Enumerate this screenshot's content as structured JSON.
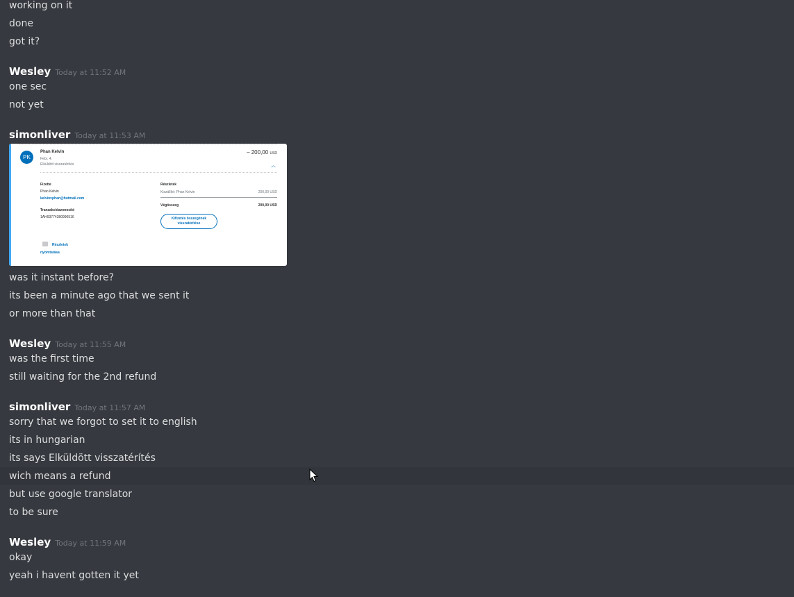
{
  "messages": [
    {
      "type": "line",
      "text": "working on it"
    },
    {
      "type": "line",
      "text": "done"
    },
    {
      "type": "line",
      "text": "got it?"
    },
    {
      "type": "header",
      "username": "Wesley",
      "timestamp": "Today at 11:52 AM"
    },
    {
      "type": "line",
      "text": "one sec"
    },
    {
      "type": "line",
      "text": "not yet"
    },
    {
      "type": "header",
      "username": "simonliver",
      "timestamp": "Today at 11:53 AM"
    },
    {
      "type": "line",
      "text": "was it instant before?"
    },
    {
      "type": "line",
      "text": "its been a minute ago that we sent it"
    },
    {
      "type": "line",
      "text": "or more than that"
    },
    {
      "type": "header",
      "username": "Wesley",
      "timestamp": "Today at 11:55 AM"
    },
    {
      "type": "line",
      "text": "was the first time"
    },
    {
      "type": "line",
      "text": "still waiting for the 2nd refund"
    },
    {
      "type": "header",
      "username": "simonliver",
      "timestamp": "Today at 11:57 AM"
    },
    {
      "type": "line",
      "text": "sorry that we forgot to set it to english"
    },
    {
      "type": "line",
      "text": "its in hungarian"
    },
    {
      "type": "line",
      "text": "its says Elküldött visszatérítés"
    },
    {
      "type": "line",
      "text": "wich means a refund"
    },
    {
      "type": "line",
      "text": "but use google translator"
    },
    {
      "type": "line",
      "text": "to be sure"
    },
    {
      "type": "header",
      "username": "Wesley",
      "timestamp": "Today at 11:59 AM"
    },
    {
      "type": "line",
      "text": "okay"
    },
    {
      "type": "line",
      "text": "yeah i havent gotten it yet"
    }
  ],
  "attachment": {
    "avatar_initials": "PK",
    "name": "Phan Kelvin",
    "date": "Febr. 4.",
    "status": "Elküldött visszatérítés",
    "amount": "– 200,00",
    "amount_currency": "USD",
    "paid_by_label": "Fizette",
    "paid_by_name": "Phan Kelvin",
    "paid_by_email": "kelvinvphan@hotmail.com",
    "transaction_id_label": "Tranzakcióazonosító",
    "transaction_id": "1AH93774380990516",
    "details_label": "Részletek",
    "details_seller": "Kiszállító: Phan Kelvin",
    "details_seller_amount": "200,00 USD",
    "total_label": "Végösszeg",
    "total_amount": "200,00 USD",
    "refund_button": "Kifizetés összegének visszatérítése",
    "print_link_line1": "Részletek",
    "print_link_line2": "nyomtatása",
    "colors": {
      "brand": "#0070ba",
      "accent_bar": "#3fa9f5"
    }
  },
  "theme": {
    "background": "#36393f",
    "hover_row": "#32353b",
    "username": "#ffffff",
    "timestamp": "#72767d",
    "text": "#dcddde"
  }
}
